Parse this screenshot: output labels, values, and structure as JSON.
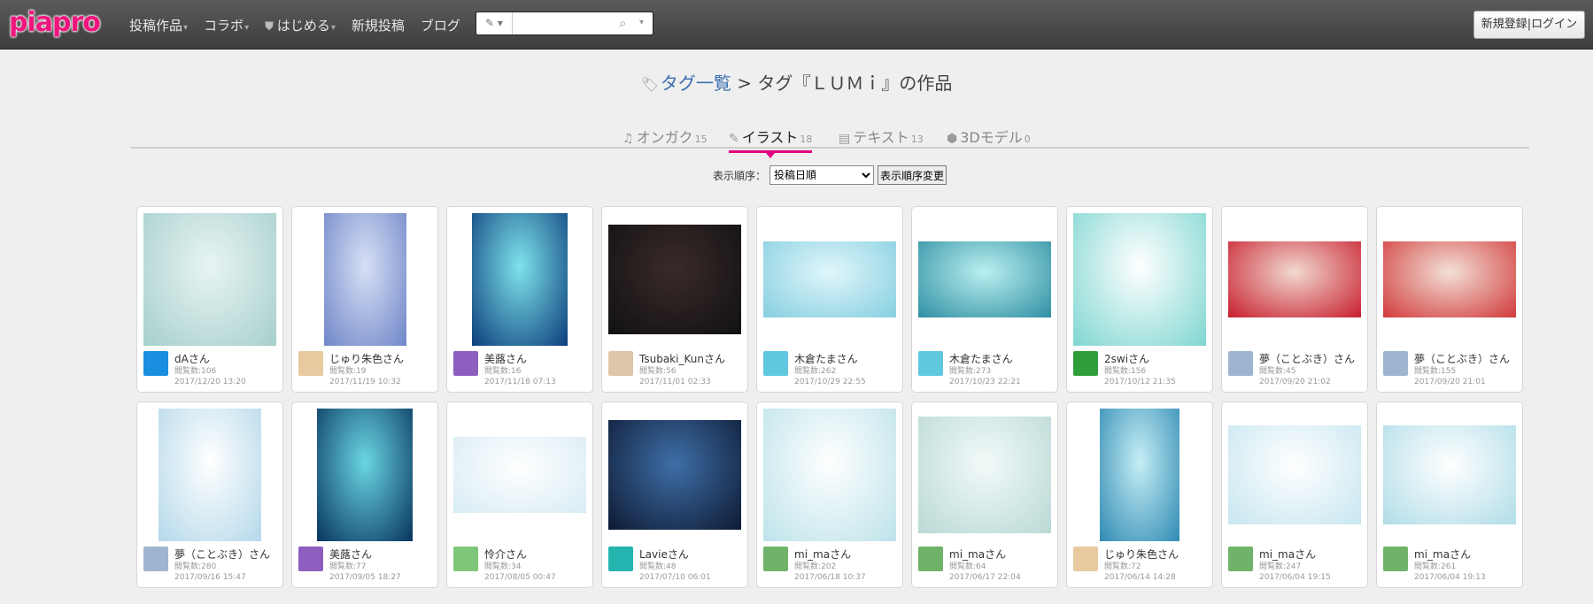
{
  "header": {
    "logo": "piapro",
    "nav": [
      {
        "label": "投稿作品",
        "caret": true,
        "shield": false
      },
      {
        "label": "コラボ",
        "caret": true,
        "shield": false
      },
      {
        "label": "はじめる",
        "caret": true,
        "shield": true
      },
      {
        "label": "新規投稿",
        "caret": false,
        "shield": false
      },
      {
        "label": "ブログ",
        "caret": false,
        "shield": false
      }
    ],
    "search": {
      "placeholder": "",
      "category_icon": "pencil-icon"
    },
    "login_label": "新規登録|ログイン"
  },
  "breadcrumb": {
    "link": "タグ一覧",
    "separator": " > ",
    "current": "タグ『ＬＵＭｉ』の作品"
  },
  "tabs": [
    {
      "label": "オンガク",
      "count": "15",
      "icon": "♫",
      "active": false
    },
    {
      "label": "イラスト",
      "count": "18",
      "icon": "✎",
      "active": true
    },
    {
      "label": "テキスト",
      "count": "13",
      "icon": "▤",
      "active": false
    },
    {
      "label": "3Dモデル",
      "count": "0",
      "icon": "⬢",
      "active": false
    }
  ],
  "sort": {
    "label": "表示順序：",
    "selected": "投稿日順",
    "button": "表示順序変更"
  },
  "works": [
    {
      "user": "dAさん",
      "views": "閲覧数:106",
      "date": "2017/12/20 13:20",
      "thumb": [
        "#e8f4f4",
        "#a6cfcb"
      ],
      "avatar": "#1a8fe0",
      "ar": [
        1,
        1
      ]
    },
    {
      "user": "じゅり朱色さん",
      "views": "閲覧数:19",
      "date": "2017/11/19 10:32",
      "thumb": [
        "#d7e0f5",
        "#6f86c8"
      ],
      "avatar": "#e8c9a0",
      "ar": [
        0.62,
        1
      ]
    },
    {
      "user": "美蕗さん",
      "views": "閲覧数:16",
      "date": "2017/11/18 07:13",
      "thumb": [
        "#7fe3ec",
        "#0b3d7a"
      ],
      "avatar": "#8c5fbf",
      "ar": [
        0.72,
        1
      ]
    },
    {
      "user": "Tsubaki_Kunさん",
      "views": "閲覧数:56",
      "date": "2017/11/01 02:33",
      "thumb": [
        "#3a2a2a",
        "#111111"
      ],
      "avatar": "#dcc7a8",
      "ar": [
        1,
        0.83
      ]
    },
    {
      "user": "木倉たまさん",
      "views": "閲覧数:262",
      "date": "2017/10/29 22:55",
      "thumb": [
        "#e0f6fb",
        "#86cfe0"
      ],
      "avatar": "#5fc8df",
      "ar": [
        1,
        0.57
      ]
    },
    {
      "user": "木倉たまさん",
      "views": "閲覧数:273",
      "date": "2017/10/23 22:21",
      "thumb": [
        "#baf0f0",
        "#2f8fa3"
      ],
      "avatar": "#5fc8df",
      "ar": [
        1,
        0.57
      ]
    },
    {
      "user": "2swiさん",
      "views": "閲覧数:156",
      "date": "2017/10/12 21:35",
      "thumb": [
        "#ffffff",
        "#7fd6d1"
      ],
      "avatar": "#2e9e3b",
      "ar": [
        1,
        1
      ]
    },
    {
      "user": "夢（ことぶき）さん",
      "views": "閲覧数:45",
      "date": "2017/09/20 21:02",
      "thumb": [
        "#f1d9cf",
        "#c81e2e"
      ],
      "avatar": "#9fb5cf",
      "ar": [
        1,
        0.57
      ]
    },
    {
      "user": "夢（ことぶき）さん",
      "views": "閲覧数:155",
      "date": "2017/09/20 21:01",
      "thumb": [
        "#f3e0d6",
        "#d13a3a"
      ],
      "avatar": "#9fb5cf",
      "ar": [
        1,
        0.57
      ]
    },
    {
      "user": "夢（ことぶき）さん",
      "views": "閲覧数:280",
      "date": "2017/09/16 15:47",
      "thumb": [
        "#ffffff",
        "#b4d8ea"
      ],
      "avatar": "#9fb5cf",
      "ar": [
        0.77,
        1
      ]
    },
    {
      "user": "美蕗さん",
      "views": "閲覧数:77",
      "date": "2017/09/05 18:27",
      "thumb": [
        "#6ad6e3",
        "#07345e"
      ],
      "avatar": "#8c5fbf",
      "ar": [
        0.72,
        1
      ]
    },
    {
      "user": "怜介さん",
      "views": "閲覧数:34",
      "date": "2017/08/05 00:47",
      "thumb": [
        "#ffffff",
        "#d8ecf4"
      ],
      "avatar": "#7fc67a",
      "ar": [
        1,
        0.57
      ]
    },
    {
      "user": "Lavieさん",
      "views": "閲覧数:48",
      "date": "2017/07/10 06:01",
      "thumb": [
        "#3f6fa8",
        "#0d1a33"
      ],
      "avatar": "#25b4b0",
      "ar": [
        1,
        0.83
      ]
    },
    {
      "user": "mi_maさん",
      "views": "閲覧数:202",
      "date": "2017/06/18 10:37",
      "thumb": [
        "#ffffff",
        "#bde3ea"
      ],
      "avatar": "#6fb36a",
      "ar": [
        1,
        1
      ]
    },
    {
      "user": "mi_maさん",
      "views": "閲覧数:64",
      "date": "2017/06/17 22:04",
      "thumb": [
        "#f2faf9",
        "#b9d9d5"
      ],
      "avatar": "#6fb36a",
      "ar": [
        1,
        0.88
      ]
    },
    {
      "user": "じゅり朱色さん",
      "views": "閲覧数:72",
      "date": "2017/06/14 14:28",
      "thumb": [
        "#c6eef5",
        "#2f8ab3"
      ],
      "avatar": "#e8c9a0",
      "ar": [
        0.6,
        1
      ]
    },
    {
      "user": "mi_maさん",
      "views": "閲覧数:247",
      "date": "2017/06/04 19:15",
      "thumb": [
        "#ffffff",
        "#c7e6f0"
      ],
      "avatar": "#6fb36a",
      "ar": [
        1,
        0.75
      ]
    },
    {
      "user": "mi_maさん",
      "views": "閲覧数:261",
      "date": "2017/06/04 19:13",
      "thumb": [
        "#ffffff",
        "#b0dde8"
      ],
      "avatar": "#6fb36a",
      "ar": [
        1,
        0.75
      ]
    }
  ]
}
